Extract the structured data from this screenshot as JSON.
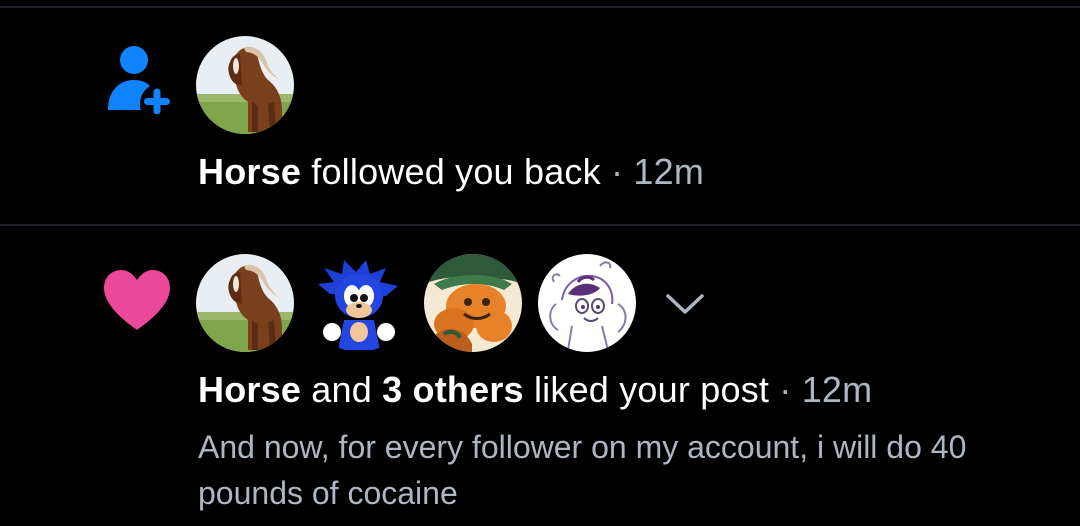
{
  "notifications": [
    {
      "type": "follow",
      "icon": "person-add-icon",
      "icon_color": "#1083fe",
      "avatars": [
        "horse-avatar"
      ],
      "actor": "Horse",
      "action": " followed you back",
      "separator": " · ",
      "time": "12m"
    },
    {
      "type": "like",
      "icon": "heart-icon",
      "icon_color": "#ec4899",
      "avatars": [
        "horse-avatar",
        "sonic-avatar",
        "orange-cartoon-avatar",
        "sketch-character-avatar"
      ],
      "expand_icon": "chevron-down-icon",
      "actor": "Horse",
      "conjunction": " and ",
      "others": "3 others",
      "action": " liked your post",
      "separator": " · ",
      "time": "12m",
      "post_text": "And now, for every follower on my account, i will do 40 pounds of cocaine"
    }
  ]
}
